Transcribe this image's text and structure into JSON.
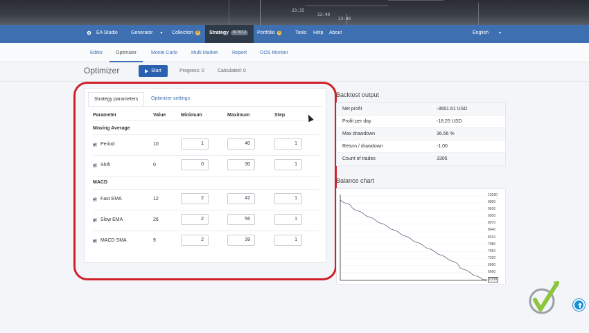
{
  "header": {
    "times": [
      "23:35",
      "23:40",
      "23:48"
    ]
  },
  "navbar": {
    "items": [
      {
        "label": "EA Studio"
      },
      {
        "label": "Generator"
      },
      {
        "label": "Collection",
        "badge": "0"
      },
      {
        "label": "Strategy",
        "badge": "ID 707.2"
      },
      {
        "label": "Portfolio",
        "badge": "0"
      },
      {
        "label": "Tools"
      },
      {
        "label": "Help"
      },
      {
        "label": "About"
      }
    ],
    "language": "English"
  },
  "subnav": {
    "tabs": [
      "Editor",
      "Optimizer",
      "Monte Carlo",
      "Multi Market",
      "Report",
      "OOS Monitor"
    ]
  },
  "optimizer": {
    "title": "Optimizer",
    "start_label": "Start",
    "progress": "Progress: 0",
    "calculated": "Calculated: 0"
  },
  "panel": {
    "tabs": [
      "Strategy parameters",
      "Optimizer settings"
    ],
    "headers": [
      "Parameter",
      "Value",
      "Minimum",
      "Maximum",
      "Step"
    ],
    "groups": [
      {
        "name": "Moving Average",
        "rows": [
          {
            "param": "Period",
            "value": "10",
            "min": "1",
            "max": "40",
            "step": "1"
          },
          {
            "param": "Shift",
            "value": "0",
            "min": "0",
            "max": "30",
            "step": "1"
          }
        ]
      },
      {
        "name": "MACD",
        "rows": [
          {
            "param": "Fast EMA",
            "value": "12",
            "min": "2",
            "max": "42",
            "step": "1"
          },
          {
            "param": "Slow EMA",
            "value": "26",
            "min": "2",
            "max": "56",
            "step": "1"
          },
          {
            "param": "MACD SMA",
            "value": "9",
            "min": "2",
            "max": "39",
            "step": "1"
          }
        ]
      }
    ]
  },
  "backtest": {
    "title": "Backtest output",
    "rows": [
      {
        "label": "Net profit",
        "value": "-3661.61 USD"
      },
      {
        "label": "Profit per day",
        "value": "-18.25 USD"
      },
      {
        "label": "Max drawdown",
        "value": "36.66 %"
      },
      {
        "label": "Return / drawdown",
        "value": "-1.00"
      },
      {
        "label": "Count of trades",
        "value": "3305"
      }
    ]
  },
  "balance_chart": {
    "title": "Balance chart",
    "y_ticks": [
      "10290",
      "9960",
      "9630",
      "9300",
      "8970",
      "8640",
      "8310",
      "7980",
      "7650",
      "7320",
      "6990",
      "6660",
      "6338"
    ],
    "line_color": "#5a6478"
  },
  "colors": {
    "nav": "#3d6fb1",
    "highlight_ring": "#d0202b",
    "start_button": "#2b62b0"
  }
}
